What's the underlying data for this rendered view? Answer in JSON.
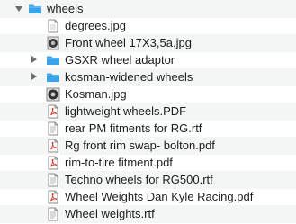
{
  "colors": {
    "folder": "#3aa4ea",
    "pdf_red": "#d8362b",
    "stripe": "#f4f5f5"
  },
  "rows": [
    {
      "label": "wheels",
      "icon": "folder-icon",
      "disclosure": "expanded"
    },
    {
      "label": "degrees.jpg",
      "icon": "image-file-icon"
    },
    {
      "label": "Front wheel 17X3,5a.jpg",
      "icon": "wheel-image-icon"
    },
    {
      "label": "GSXR wheel adaptor",
      "icon": "folder-icon",
      "disclosure": "collapsed"
    },
    {
      "label": "kosman-widened wheels",
      "icon": "folder-icon",
      "disclosure": "collapsed"
    },
    {
      "label": "Kosman.jpg",
      "icon": "wheel-image-icon"
    },
    {
      "label": "lightweight wheels.PDF",
      "icon": "pdf-file-icon"
    },
    {
      "label": "rear PM fitments for RG.rtf",
      "icon": "document-file-icon"
    },
    {
      "label": "Rg front rim swap- bolton.pdf",
      "icon": "pdf-file-icon"
    },
    {
      "label": "rim-to-tire fitment.pdf",
      "icon": "pdf-file-icon"
    },
    {
      "label": "Techno wheels for RG500.rtf",
      "icon": "document-file-icon"
    },
    {
      "label": "Wheel Weights  Dan Kyle Racing.pdf",
      "icon": "pdf-file-icon"
    },
    {
      "label": "Wheel weights.rtf",
      "icon": "document-file-icon"
    }
  ]
}
